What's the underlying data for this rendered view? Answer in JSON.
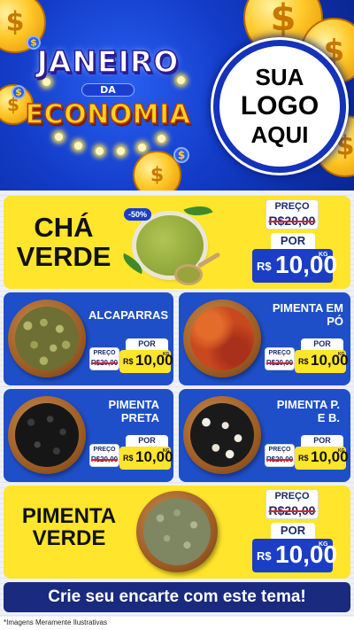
{
  "header": {
    "title_line1": "JANEIRO",
    "title_line2": "DA",
    "title_line3": "ECONOMIA",
    "logo_line1": "SUA",
    "logo_line2": "LOGO",
    "logo_line3": "AQUI"
  },
  "colors": {
    "header_blue": "#123cc8",
    "card_yellow": "#ffe52b",
    "card_blue": "#1f4fc8",
    "price_blue": "#1b3ec4",
    "cta_navy": "#1a2a7e"
  },
  "featured": [
    {
      "name_line1": "CHÁ",
      "name_line2": "VERDE",
      "badge": "-50%",
      "old_label": "PREÇO",
      "old_price": "R$20,00",
      "por_label": "POR",
      "currency": "R$",
      "price": "10,00",
      "unit": "KG",
      "image_icon": "green-tea-bowl-icon"
    },
    {
      "name_line1": "PIMENTA",
      "name_line2": "VERDE",
      "old_label": "PREÇO",
      "old_price": "R$20,00",
      "por_label": "POR",
      "currency": "R$",
      "price": "10,00",
      "unit": "KG",
      "image_icon": "green-pepper-bowl-icon"
    }
  ],
  "products": [
    {
      "name_line1": "ALCAPARRAS",
      "name_line2": "",
      "old_label": "PREÇO",
      "old_price": "R$20,00",
      "por_label": "POR",
      "currency": "R$",
      "price": "10,00",
      "unit": "KG",
      "image_icon": "capers-bowl-icon"
    },
    {
      "name_line1": "PIMENTA EM",
      "name_line2": "PÓ",
      "old_label": "PREÇO",
      "old_price": "R$20,00",
      "por_label": "POR",
      "currency": "R$",
      "price": "10,00",
      "unit": "KG",
      "image_icon": "pepper-powder-bowl-icon"
    },
    {
      "name_line1": "PIMENTA",
      "name_line2": "PRETA",
      "old_label": "PREÇO",
      "old_price": "R$20,00",
      "por_label": "POR",
      "currency": "R$",
      "price": "10,00",
      "unit": "KG",
      "image_icon": "black-pepper-bowl-icon"
    },
    {
      "name_line1": "PIMENTA P.",
      "name_line2": "E B.",
      "old_label": "PREÇO",
      "old_price": "R$20,00",
      "por_label": "POR",
      "currency": "R$",
      "price": "10,00",
      "unit": "KG",
      "image_icon": "mixed-pepper-bowl-icon"
    }
  ],
  "cta": {
    "label": "Crie seu encarte com este tema!"
  },
  "footnote": "*Imagens Meramente Ilustrativas"
}
